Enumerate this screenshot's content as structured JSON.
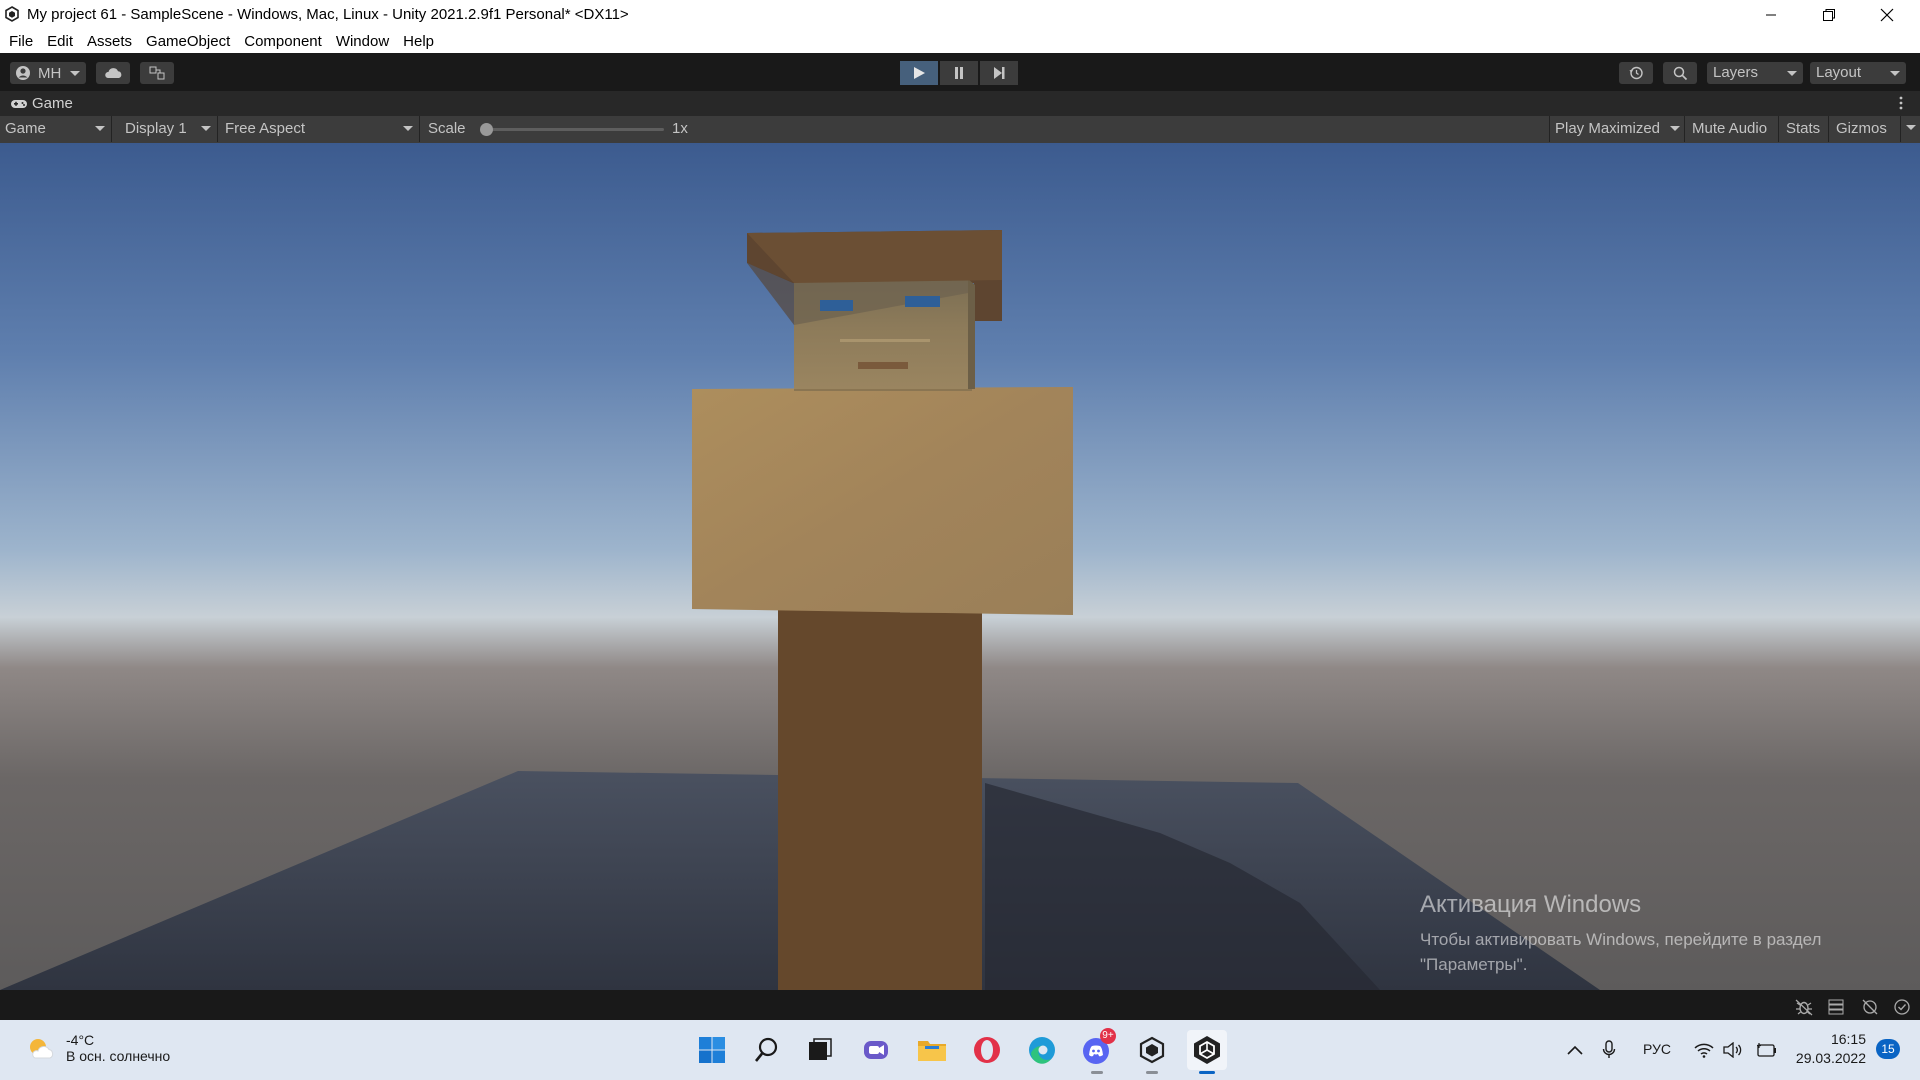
{
  "window": {
    "title": "My project 61 - SampleScene - Windows, Mac, Linux - Unity 2021.2.9f1 Personal* <DX11>"
  },
  "menu": [
    "File",
    "Edit",
    "Assets",
    "GameObject",
    "Component",
    "Window",
    "Help"
  ],
  "toolbar": {
    "account_label": "MH",
    "layers_label": "Layers",
    "layout_label": "Layout"
  },
  "tab": {
    "label": "Game"
  },
  "game_bar": {
    "view_select": "Game",
    "display_select": "Display 1",
    "aspect_select": "Free Aspect",
    "scale_label": "Scale",
    "scale_value": "1x",
    "play_maximized": "Play Maximized",
    "mute_audio": "Mute Audio",
    "stats": "Stats",
    "gizmos": "Gizmos"
  },
  "watermark": {
    "title": "Активация Windows",
    "line1": "Чтобы активировать Windows, перейдите в раздел",
    "line2": "\"Параметры\"."
  },
  "taskbar": {
    "weather_temp": "-4°C",
    "weather_desc": "В осн. солнечно",
    "chat_badge": "9+",
    "language": "РУС",
    "time": "16:15",
    "date": "29.03.2022",
    "notification_count": "15"
  },
  "colors": {
    "play_active": "#46607c",
    "accent": "#0a64c4"
  }
}
